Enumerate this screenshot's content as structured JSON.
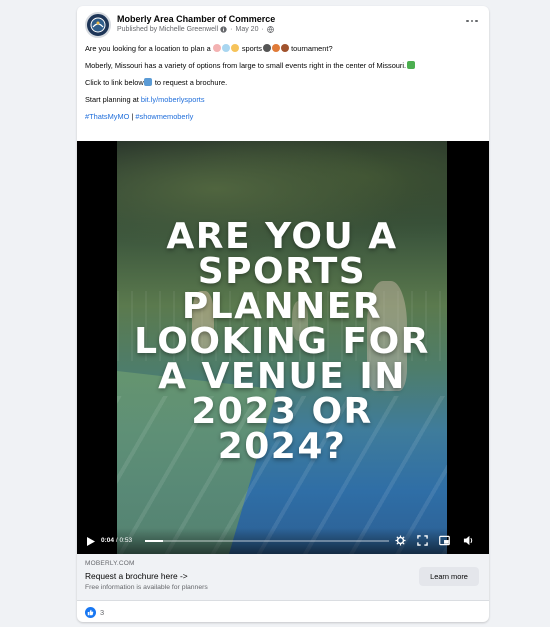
{
  "post": {
    "page_name": "Moberly Area Chamber of Commerce",
    "published_by": "Published by Michelle Greenwell",
    "date": "May 20",
    "separator": "·",
    "line1_a": "Are you looking for a location to plan a",
    "line1_b": "sports",
    "line1_c": "tournament?",
    "line2": "Moberly, Missouri has a variety of options from large to small events right in the center of Missouri.",
    "line3_a": "Click to link below",
    "line3_b": "to request a brochure.",
    "line4_prefix": "Start planning at",
    "line4_link": "bit.ly/moberlysports",
    "hashtag1": "#ThatsMyMO",
    "hashtag_sep": "|",
    "hashtag2": "#showmemoberly"
  },
  "video": {
    "headline_lines": [
      "ARE YOU A",
      "SPORTS",
      "PLANNER",
      "LOOKING FOR",
      "A VENUE IN",
      "2023 OR",
      "2024?"
    ],
    "current_time": "0:04",
    "time_sep": " / ",
    "duration": "0:53",
    "progress": 0.075
  },
  "link_preview": {
    "domain": "MOBERLY.COM",
    "title": "Request a brochure here ->",
    "subtitle": "Free information is available for planners",
    "button": "Learn more"
  },
  "reactions": {
    "count": "3"
  },
  "colors": {
    "link": "#216fdb",
    "like": "#1877f2"
  }
}
